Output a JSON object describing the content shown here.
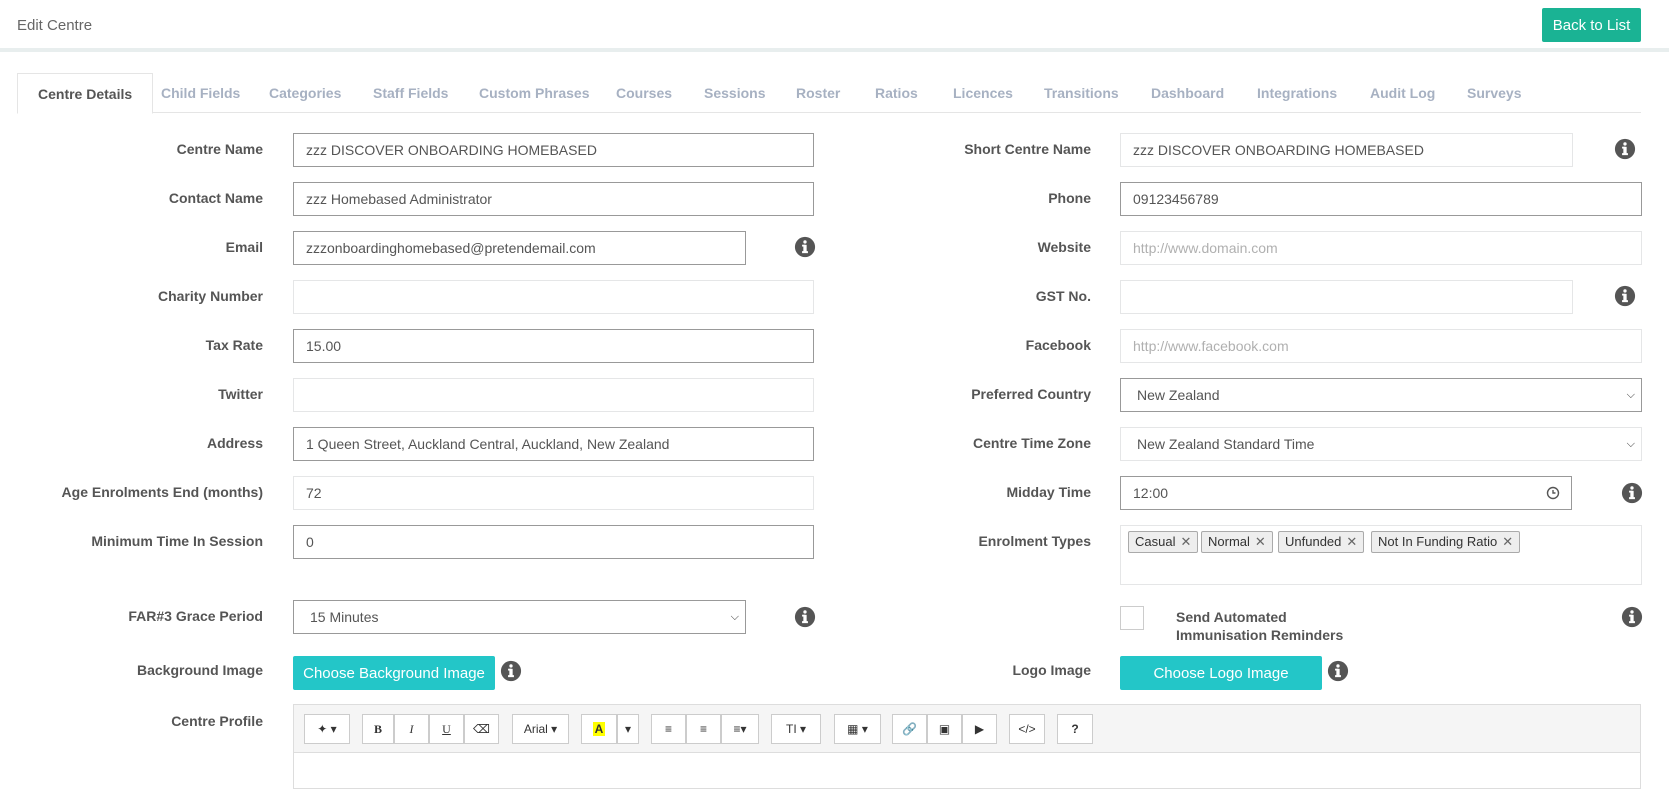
{
  "header": {
    "title": "Edit Centre",
    "back_label": "Back to List"
  },
  "tabs": [
    "Centre Details",
    "Child Fields",
    "Categories",
    "Staff Fields",
    "Custom Phrases",
    "Courses",
    "Sessions",
    "Roster",
    "Ratios",
    "Licences",
    "Transitions",
    "Dashboard",
    "Integrations",
    "Audit Log",
    "Surveys"
  ],
  "form": {
    "centre_name": {
      "label": "Centre Name",
      "value": "zzz DISCOVER ONBOARDING HOMEBASED"
    },
    "short_centre_name": {
      "label": "Short Centre Name",
      "value": "zzz DISCOVER ONBOARDING HOMEBASED"
    },
    "contact_name": {
      "label": "Contact Name",
      "value": "zzz Homebased Administrator"
    },
    "phone": {
      "label": "Phone",
      "value": "09123456789"
    },
    "email": {
      "label": "Email",
      "value": "zzzonboardinghomebased@pretendemail.com"
    },
    "website": {
      "label": "Website",
      "placeholder": "http://www.domain.com"
    },
    "charity_number": {
      "label": "Charity Number",
      "value": ""
    },
    "gst_no": {
      "label": "GST No.",
      "value": ""
    },
    "tax_rate": {
      "label": "Tax Rate",
      "value": "15.00"
    },
    "facebook": {
      "label": "Facebook",
      "placeholder": "http://www.facebook.com"
    },
    "twitter": {
      "label": "Twitter",
      "value": ""
    },
    "preferred_country": {
      "label": "Preferred Country",
      "value": "New Zealand"
    },
    "address": {
      "label": "Address",
      "value": "1 Queen Street, Auckland Central, Auckland, New Zealand"
    },
    "centre_time_zone": {
      "label": "Centre Time Zone",
      "value": "New Zealand Standard Time"
    },
    "age_enrolments_end": {
      "label": "Age Enrolments End (months)",
      "value": "72"
    },
    "midday_time": {
      "label": "Midday Time",
      "value": "12:00"
    },
    "minimum_time_in_session": {
      "label": "Minimum Time In Session",
      "value": "0"
    },
    "enrolment_types": {
      "label": "Enrolment Types",
      "tags": [
        "Casual",
        "Normal",
        "Unfunded",
        "Not In Funding Ratio"
      ]
    },
    "far3_grace_period": {
      "label": "FAR#3 Grace Period",
      "value": "15 Minutes"
    },
    "immunisation_reminders": {
      "label_line1": "Send Automated",
      "label_line2": "Immunisation Reminders",
      "checked": false
    },
    "background_image": {
      "label": "Background Image",
      "button": "Choose Background Image"
    },
    "logo_image": {
      "label": "Logo Image",
      "button": "Choose Logo Image"
    },
    "centre_profile": {
      "label": "Centre Profile"
    }
  },
  "editor_toolbar": {
    "bold": "B",
    "italic": "I",
    "underline": "U",
    "font": "Arial",
    "font_size": "T",
    "help": "?",
    "code": "</>"
  },
  "colors": {
    "primary": "#1ab394",
    "teal": "#23c6c8",
    "info_icon": "#555555"
  }
}
